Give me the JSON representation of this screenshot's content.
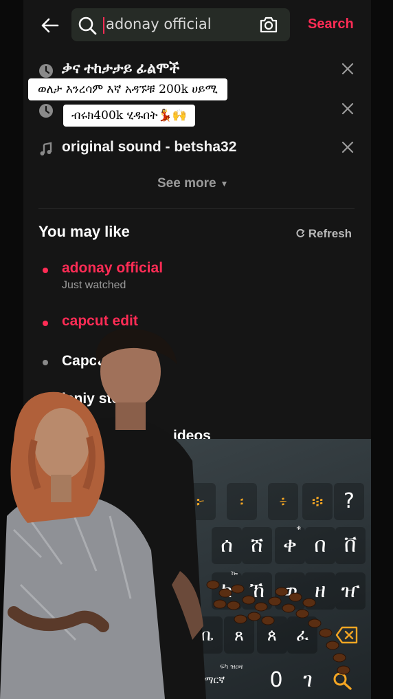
{
  "header": {
    "search_value": "adonay official",
    "search_button": "Search"
  },
  "history": [
    {
      "icon": "clock-icon",
      "label": "ቃና ተከታታይ ፊልሞች"
    },
    {
      "icon": "clock-icon",
      "label": ""
    },
    {
      "icon": "music-note-icon",
      "label": "original sound - betsha32"
    }
  ],
  "see_more": "See more",
  "you_may_like": {
    "title": "You may like",
    "refresh": "Refresh",
    "items": [
      {
        "label": "adonay official",
        "sub": "Just watched",
        "color": "#fe2c55"
      },
      {
        "label": "capcut edit",
        "sub": "",
        "color": "#fe2c55"
      },
      {
        "label": "Capcut تصاميم",
        "sub": "",
        "color": "#ffffff"
      },
      {
        "label": "ieniy story",
        "sub": "",
        "color": "#ffffff"
      },
      {
        "label": "ideos",
        "sub": "",
        "color": "#ffffff"
      }
    ]
  },
  "caption": {
    "line1": "ወለታ እንረሳም እኛ አዳኙቹ 200k  ሀይሚ",
    "line2": "ብሩክ400k ሂዱበት💃🙌"
  },
  "keyboard": {
    "row1": [
      "፦",
      "፡",
      "፥",
      "፨",
      "?"
    ],
    "row2": [
      "ሰ",
      "ሸ",
      "ቀ",
      "በ",
      "ቨ"
    ],
    "row3": [
      "ከ",
      "ኸ",
      "ወ",
      "ዘ",
      "ዠ"
    ],
    "row4": [
      "ቤ",
      "ጸ",
      "ጰ",
      "ፈ"
    ],
    "row5": [
      "አማርኛ",
      "0",
      "ገ"
    ],
    "lang_hint": "ፍካ ዝዐዛ",
    "row3_hint": "ኰ",
    "row2_hint": "ቁ",
    "accent": "#f5a623"
  }
}
